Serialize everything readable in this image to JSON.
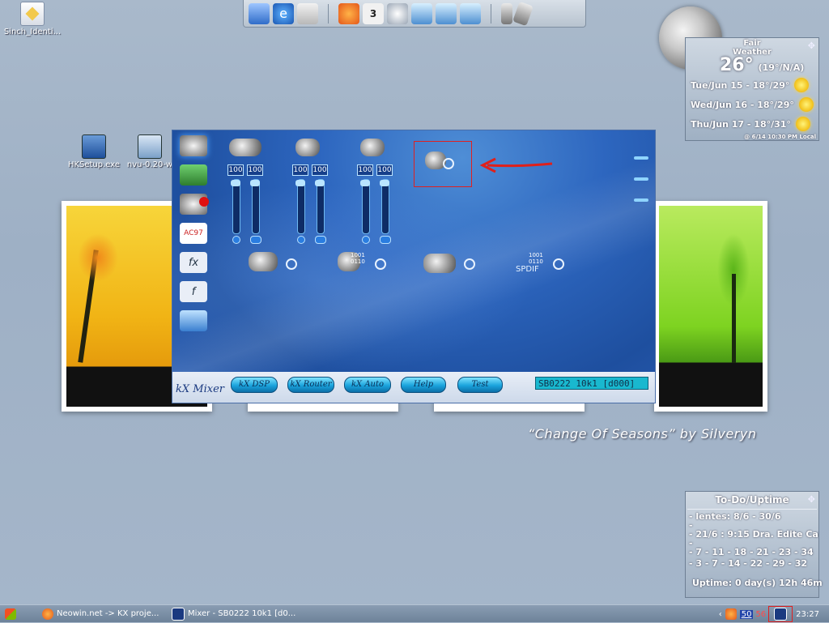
{
  "desktop": {
    "icons": [
      {
        "label": "Sinch_Identi...",
        "icon": "shortcut-icon"
      },
      {
        "label": "HKSetup.exe",
        "icon": "setup-icon"
      },
      {
        "label": "nvu-0.20-w",
        "icon": "installer-icon"
      }
    ],
    "wallpaper_caption": "“Change Of Seasons” by Silveryn"
  },
  "dock": {
    "badge": "3",
    "icons": [
      "my-computer-icon",
      "internet-explorer-icon",
      "recycle-bin-icon",
      "firefox-icon",
      "calendar-icon",
      "media-disc-icon",
      "network-icon",
      "network-2-icon",
      "network-3-icon",
      "phone-icon",
      "mobile-phone-icon"
    ]
  },
  "weather": {
    "condition": "Fair\nWeather",
    "temp": "26°",
    "feels": "(19°/N/A)",
    "forecast": [
      {
        "text": "Tue/Jun 15 - 18°/29°"
      },
      {
        "text": "Wed/Jun 16 - 18°/29°"
      },
      {
        "text": "Thu/Jun 17 - 18°/31°"
      }
    ],
    "updated": "@ 6/14 10:30 PM Local"
  },
  "mixer": {
    "title": "kX Mixer",
    "buttons": [
      "kX DSP",
      "kX Router",
      "kX Auto",
      "Help",
      "Test"
    ],
    "device": "SB0222 10k1 [d000]",
    "levels": [
      "100",
      "100",
      "100",
      "100",
      "100",
      "100"
    ],
    "spdif_label": "SPDIF",
    "bits_label": "1001\n0110"
  },
  "todo": {
    "title": "To-Do/Uptime",
    "items": [
      "- lentes: 8/6 - 30/6",
      "-",
      "- 21/6 : 9:15 Dra. Edite Carva",
      "-",
      "- 7 - 11 - 18 - 21 - 23 - 34",
      "- 3 - 7 - 14 - 22 - 29 - 32"
    ],
    "uptime": "Uptime: 0 day(s) 12h 46m"
  },
  "taskbar": {
    "tasks": [
      {
        "label": "Neowin.net -> KX proje..."
      },
      {
        "label": "Mixer - SB0222 10k1 [d0..."
      }
    ],
    "tray_num1": "50",
    "tray_num2": "56",
    "clock": "23:27"
  }
}
